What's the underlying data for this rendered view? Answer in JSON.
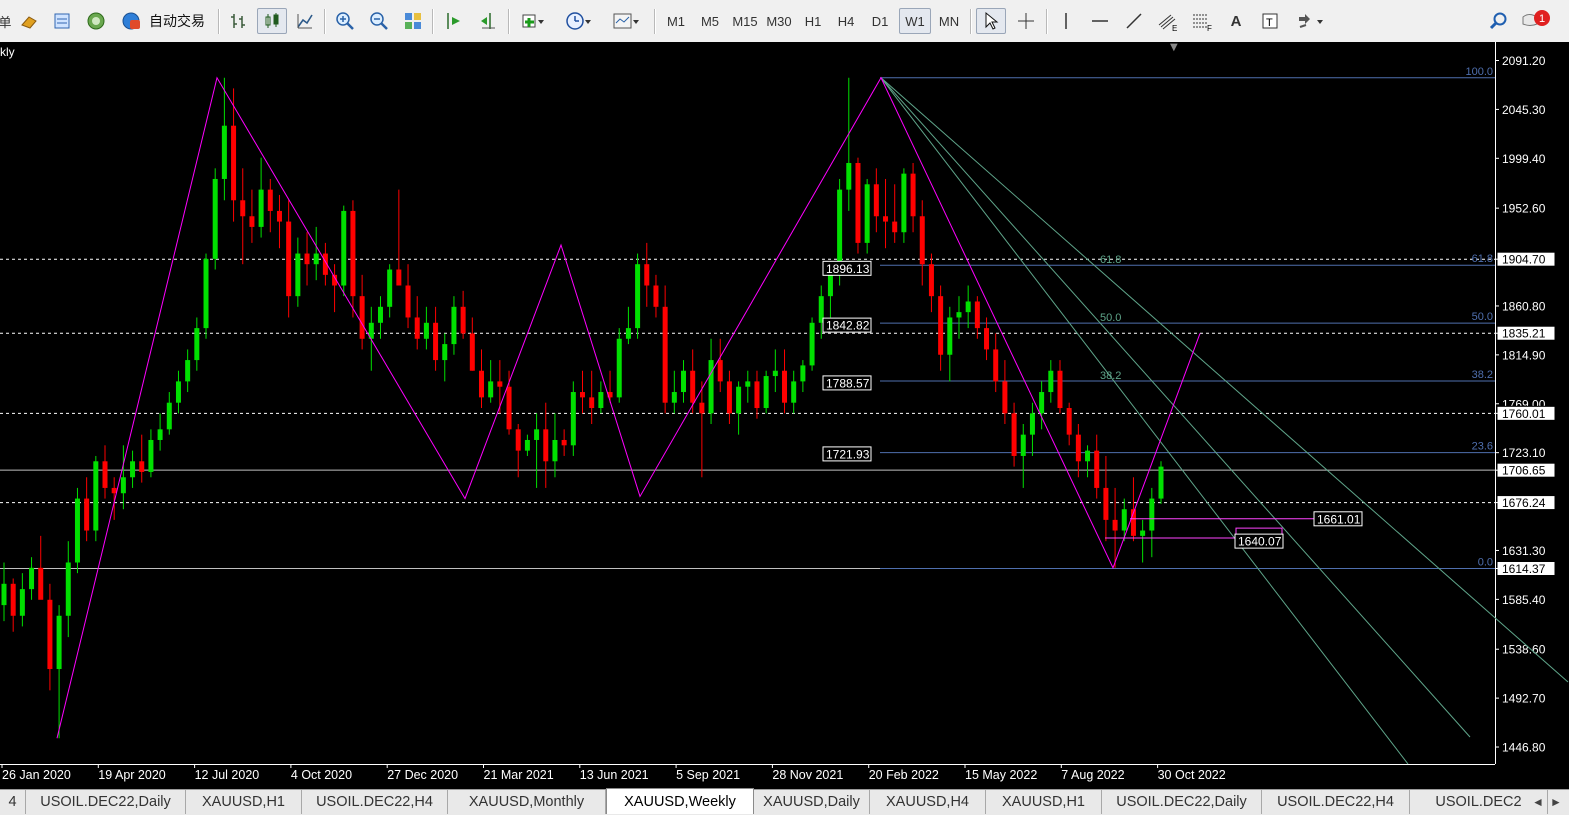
{
  "toolbar": {
    "partial_left_label": "单",
    "auto_trading_label": "自动交易",
    "timeframes": [
      "M1",
      "M5",
      "M15",
      "M30",
      "H1",
      "H4",
      "D1",
      "W1",
      "MN"
    ],
    "active_timeframe": "W1",
    "text_tool_label": "A",
    "notification_count": "1"
  },
  "chart": {
    "symbol_partial": "kly",
    "background": "#000000",
    "bull_color": "#00e000",
    "bear_color": "#ff0000",
    "zigzag_color": "#ff00ff",
    "fib_color": "#4f6fae",
    "fan_color": "#5fa58a",
    "price_axis": [
      "2091.20",
      "2045.30",
      "1999.40",
      "1952.60",
      "1904.70",
      "1860.80",
      "1835.21",
      "1814.90",
      "1769.00",
      "1760.01",
      "1723.10",
      "1706.65",
      "1676.24",
      "1631.30",
      "1614.37",
      "1585.40",
      "1538.60",
      "1492.70",
      "1446.80"
    ],
    "highlighted_prices": [
      "1904.70",
      "1835.21",
      "1760.01",
      "1706.65",
      "1676.24",
      "1614.37"
    ],
    "date_axis": [
      "26 Jan 2020",
      "19 Apr 2020",
      "12 Jul 2020",
      "4 Oct 2020",
      "27 Dec 2020",
      "21 Mar 2021",
      "13 Jun 2021",
      "5 Sep 2021",
      "28 Nov 2021",
      "20 Feb 2022",
      "15 May 2022",
      "7 Aug 2022",
      "30 Oct 2022"
    ],
    "fib_levels_right": [
      "100.0",
      "61.8",
      "50.0",
      "38.2",
      "23.6",
      "0.0"
    ],
    "fib_levels_mid": [
      "61.8",
      "50.0",
      "38.2"
    ],
    "price_labels": [
      "1896.13",
      "1842.82",
      "1788.57",
      "1721.93",
      "1661.01",
      "1640.07"
    ],
    "candles": [
      [
        1580,
        1620,
        1565,
        1600
      ],
      [
        1600,
        1605,
        1555,
        1570
      ],
      [
        1570,
        1610,
        1560,
        1595
      ],
      [
        1595,
        1625,
        1585,
        1615
      ],
      [
        1615,
        1645,
        1600,
        1585
      ],
      [
        1585,
        1600,
        1500,
        1520
      ],
      [
        1520,
        1580,
        1455,
        1570
      ],
      [
        1570,
        1640,
        1550,
        1620
      ],
      [
        1620,
        1690,
        1610,
        1680
      ],
      [
        1680,
        1700,
        1640,
        1650
      ],
      [
        1650,
        1720,
        1640,
        1715
      ],
      [
        1715,
        1730,
        1680,
        1690
      ],
      [
        1690,
        1700,
        1660,
        1685
      ],
      [
        1685,
        1730,
        1670,
        1700
      ],
      [
        1700,
        1725,
        1690,
        1715
      ],
      [
        1715,
        1740,
        1695,
        1705
      ],
      [
        1705,
        1745,
        1700,
        1735
      ],
      [
        1735,
        1760,
        1725,
        1745
      ],
      [
        1745,
        1780,
        1740,
        1770
      ],
      [
        1770,
        1800,
        1760,
        1790
      ],
      [
        1790,
        1820,
        1780,
        1810
      ],
      [
        1810,
        1850,
        1800,
        1840
      ],
      [
        1840,
        1910,
        1830,
        1905
      ],
      [
        1905,
        1990,
        1895,
        1980
      ],
      [
        1980,
        2075,
        1960,
        2030
      ],
      [
        2030,
        2065,
        1940,
        1960
      ],
      [
        1960,
        1990,
        1900,
        1945
      ],
      [
        1945,
        1970,
        1920,
        1935
      ],
      [
        1935,
        2000,
        1925,
        1970
      ],
      [
        1970,
        1980,
        1930,
        1950
      ],
      [
        1950,
        1965,
        1915,
        1940
      ],
      [
        1940,
        1960,
        1850,
        1870
      ],
      [
        1870,
        1925,
        1860,
        1910
      ],
      [
        1910,
        1930,
        1880,
        1900
      ],
      [
        1900,
        1935,
        1885,
        1910
      ],
      [
        1910,
        1920,
        1880,
        1890
      ],
      [
        1890,
        1900,
        1855,
        1880
      ],
      [
        1880,
        1955,
        1870,
        1950
      ],
      [
        1950,
        1960,
        1850,
        1870
      ],
      [
        1870,
        1890,
        1820,
        1830
      ],
      [
        1830,
        1860,
        1800,
        1845
      ],
      [
        1845,
        1870,
        1830,
        1860
      ],
      [
        1860,
        1900,
        1850,
        1895
      ],
      [
        1895,
        1970,
        1880,
        1880
      ],
      [
        1880,
        1900,
        1840,
        1850
      ],
      [
        1850,
        1870,
        1820,
        1830
      ],
      [
        1830,
        1860,
        1820,
        1845
      ],
      [
        1845,
        1860,
        1800,
        1810
      ],
      [
        1810,
        1835,
        1790,
        1825
      ],
      [
        1825,
        1870,
        1815,
        1860
      ],
      [
        1860,
        1875,
        1830,
        1835
      ],
      [
        1835,
        1850,
        1800,
        1800
      ],
      [
        1800,
        1820,
        1765,
        1775
      ],
      [
        1775,
        1810,
        1770,
        1790
      ],
      [
        1790,
        1810,
        1760,
        1785
      ],
      [
        1785,
        1800,
        1740,
        1745
      ],
      [
        1745,
        1750,
        1700,
        1725
      ],
      [
        1725,
        1740,
        1720,
        1735
      ],
      [
        1735,
        1760,
        1690,
        1745
      ],
      [
        1745,
        1770,
        1690,
        1715
      ],
      [
        1715,
        1760,
        1700,
        1735
      ],
      [
        1735,
        1745,
        1720,
        1730
      ],
      [
        1730,
        1790,
        1720,
        1780
      ],
      [
        1780,
        1800,
        1760,
        1775
      ],
      [
        1775,
        1800,
        1750,
        1765
      ],
      [
        1765,
        1790,
        1760,
        1780
      ],
      [
        1780,
        1800,
        1770,
        1775
      ],
      [
        1775,
        1840,
        1770,
        1830
      ],
      [
        1830,
        1860,
        1825,
        1840
      ],
      [
        1840,
        1910,
        1830,
        1900
      ],
      [
        1900,
        1920,
        1860,
        1880
      ],
      [
        1880,
        1890,
        1850,
        1860
      ],
      [
        1860,
        1880,
        1760,
        1770
      ],
      [
        1770,
        1800,
        1760,
        1780
      ],
      [
        1780,
        1810,
        1770,
        1800
      ],
      [
        1800,
        1820,
        1760,
        1770
      ],
      [
        1770,
        1790,
        1700,
        1760
      ],
      [
        1760,
        1830,
        1750,
        1810
      ],
      [
        1810,
        1830,
        1780,
        1790
      ],
      [
        1790,
        1800,
        1750,
        1760
      ],
      [
        1760,
        1790,
        1740,
        1785
      ],
      [
        1785,
        1800,
        1770,
        1790
      ],
      [
        1790,
        1800,
        1755,
        1765
      ],
      [
        1765,
        1800,
        1760,
        1795
      ],
      [
        1795,
        1820,
        1780,
        1800
      ],
      [
        1800,
        1820,
        1760,
        1770
      ],
      [
        1770,
        1800,
        1760,
        1790
      ],
      [
        1790,
        1810,
        1780,
        1805
      ],
      [
        1805,
        1850,
        1800,
        1845
      ],
      [
        1845,
        1880,
        1830,
        1870
      ],
      [
        1870,
        1900,
        1850,
        1890
      ],
      [
        1890,
        1980,
        1880,
        1970
      ],
      [
        1970,
        2075,
        1950,
        1995
      ],
      [
        1995,
        2000,
        1910,
        1920
      ],
      [
        1920,
        1980,
        1910,
        1975
      ],
      [
        1975,
        1990,
        1930,
        1945
      ],
      [
        1945,
        1980,
        1915,
        1940
      ],
      [
        1940,
        1975,
        1920,
        1930
      ],
      [
        1930,
        1990,
        1920,
        1985
      ],
      [
        1985,
        1995,
        1930,
        1945
      ],
      [
        1945,
        1960,
        1880,
        1900
      ],
      [
        1900,
        1910,
        1855,
        1870
      ],
      [
        1870,
        1880,
        1800,
        1815
      ],
      [
        1815,
        1860,
        1790,
        1850
      ],
      [
        1850,
        1870,
        1830,
        1855
      ],
      [
        1855,
        1880,
        1840,
        1865
      ],
      [
        1865,
        1870,
        1830,
        1840
      ],
      [
        1840,
        1850,
        1810,
        1820
      ],
      [
        1820,
        1835,
        1780,
        1790
      ],
      [
        1790,
        1810,
        1750,
        1760
      ],
      [
        1760,
        1770,
        1710,
        1720
      ],
      [
        1720,
        1750,
        1690,
        1740
      ],
      [
        1740,
        1770,
        1720,
        1760
      ],
      [
        1760,
        1790,
        1745,
        1780
      ],
      [
        1780,
        1810,
        1770,
        1800
      ],
      [
        1800,
        1810,
        1760,
        1765
      ],
      [
        1765,
        1770,
        1730,
        1740
      ],
      [
        1740,
        1750,
        1700,
        1715
      ],
      [
        1715,
        1730,
        1700,
        1725
      ],
      [
        1725,
        1740,
        1680,
        1690
      ],
      [
        1690,
        1720,
        1640,
        1660
      ],
      [
        1660,
        1690,
        1615,
        1650
      ],
      [
        1650,
        1680,
        1640,
        1670
      ],
      [
        1670,
        1700,
        1640,
        1645
      ],
      [
        1645,
        1660,
        1620,
        1650
      ],
      [
        1650,
        1690,
        1625,
        1680
      ],
      [
        1680,
        1715,
        1675,
        1710
      ]
    ],
    "crosshair_marker": "▼"
  },
  "tabs": {
    "items": [
      "4",
      "USOIL.DEC22,Daily",
      "XAUUSD,H1",
      "USOIL.DEC22,H4",
      "XAUUSD,Monthly",
      "XAUUSD,Weekly",
      "XAUUSD,Daily",
      "XAUUSD,H4",
      "XAUUSD,H1",
      "USOIL.DEC22,Daily",
      "USOIL.DEC22,H4",
      "USOIL.DEC2"
    ],
    "active": "XAUUSD,Weekly",
    "nav_left": "◄",
    "nav_right": "►"
  }
}
